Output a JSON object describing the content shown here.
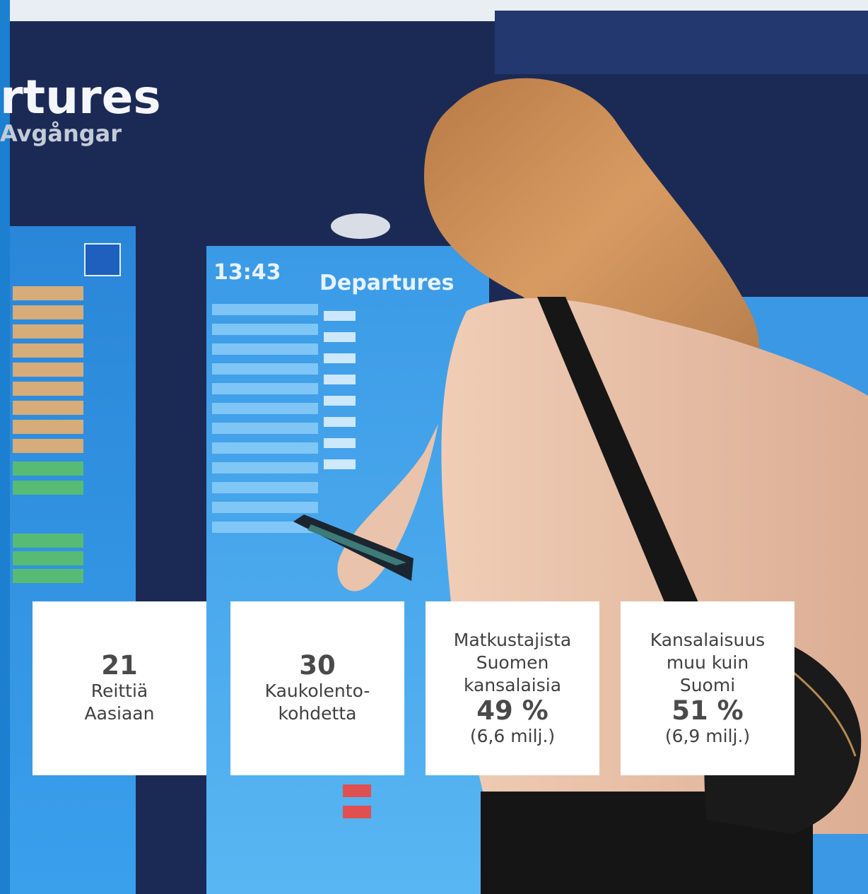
{
  "colors": {
    "board_blue": "#1f5fbe",
    "screen_blue": "#2f8fe0",
    "sweater": "#e7c0a8",
    "hair": "#c98a56",
    "card_bg": "#ffffff",
    "card_text": "#404040",
    "side_stripe": "#1c7fd0"
  },
  "sign": {
    "title_fragment": "rtures",
    "subtitle_fragment": "Avgångar",
    "board_time": "13:43",
    "board_title": "Departures"
  },
  "cards": [
    {
      "value": "21",
      "label_1": "Reittiä",
      "label_2": "Aasiaan"
    },
    {
      "value": "30",
      "label_1": "Kaukolento-",
      "label_2": "kohdetta"
    },
    {
      "line_1": "Matkustajista",
      "line_2": "Suomen",
      "line_3": "kansalaisia",
      "value": "49 %",
      "sub": "(6,6 milj.)"
    },
    {
      "line_1": "Kansalaisuus",
      "line_2": "muu kuin",
      "line_3": "Suomi",
      "value": "51 %",
      "sub": "(6,9 milj.)"
    }
  ]
}
